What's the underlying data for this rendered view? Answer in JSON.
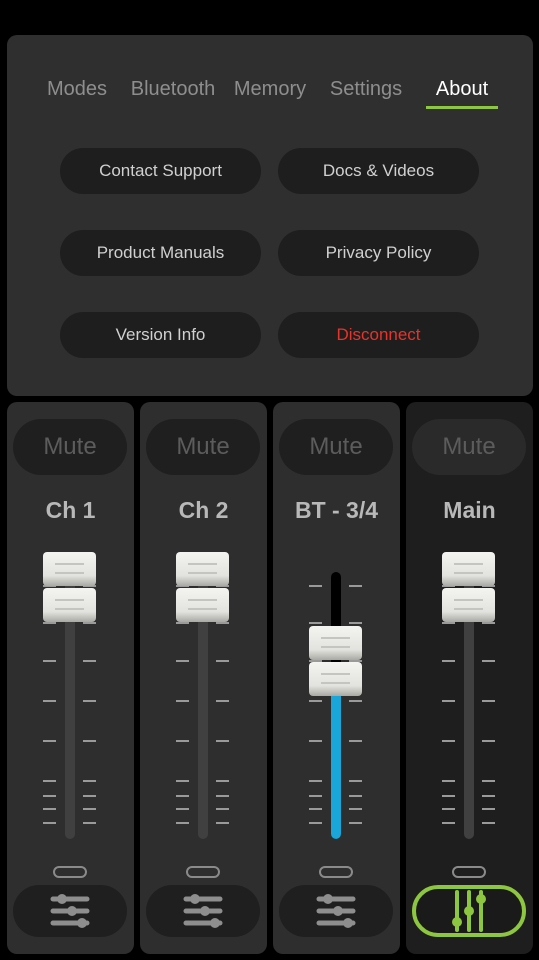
{
  "tabs": [
    {
      "label": "Modes",
      "active": false
    },
    {
      "label": "Bluetooth",
      "active": false
    },
    {
      "label": "Memory",
      "active": false
    },
    {
      "label": "Settings",
      "active": false
    },
    {
      "label": "About",
      "active": true
    }
  ],
  "buttons": [
    {
      "label": "Contact Support",
      "color": "#d0d0d0"
    },
    {
      "label": "Docs & Videos",
      "color": "#d0d0d0"
    },
    {
      "label": "Product Manuals",
      "color": "#d0d0d0"
    },
    {
      "label": "Privacy Policy",
      "color": "#d0d0d0"
    },
    {
      "label": "Version Info",
      "color": "#d0d0d0"
    },
    {
      "label": "Disconnect",
      "color": "#e8322a"
    }
  ],
  "channels": [
    {
      "mute": "Mute",
      "name": "Ch 1",
      "level": 1.0,
      "fill_color": null,
      "eq_icon": "sliders-icon",
      "selected": false
    },
    {
      "mute": "Mute",
      "name": "Ch 2",
      "level": 1.0,
      "fill_color": null,
      "eq_icon": "sliders-icon",
      "selected": false
    },
    {
      "mute": "Mute",
      "name": "BT - 3/4",
      "level": 0.66,
      "fill_color": "#1aa6d8",
      "eq_icon": "sliders-icon",
      "selected": false
    },
    {
      "mute": "Mute",
      "name": "Main",
      "level": 1.0,
      "fill_color": null,
      "eq_icon": "vertical-faders-icon",
      "selected": true
    }
  ],
  "accent": "#8dc63f"
}
